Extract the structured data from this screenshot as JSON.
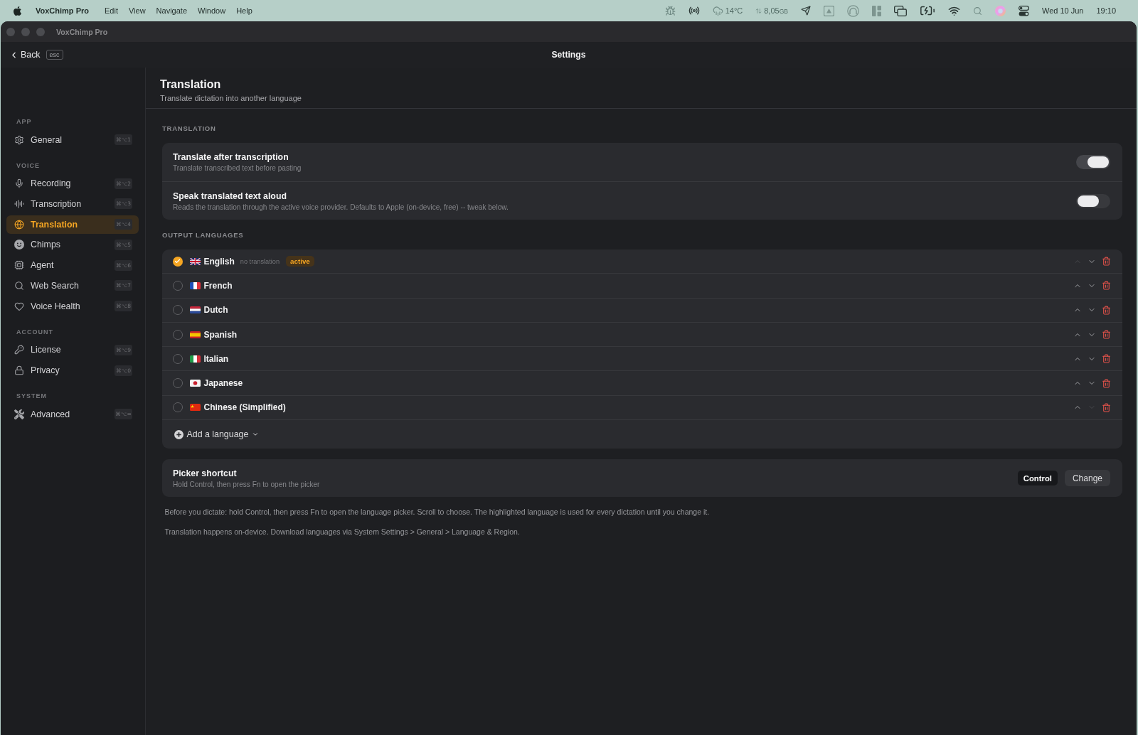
{
  "menu_bar": {
    "app_name": "VoxChimp Pro",
    "menus": [
      "Edit",
      "View",
      "Navigate",
      "Window",
      "Help"
    ],
    "weather": "14°C",
    "memory": "8,05",
    "memory_unit": "GB",
    "date": "Wed 10 Jun",
    "time": "19:10"
  },
  "window": {
    "title": "VoxChimp Pro"
  },
  "toolbar": {
    "back": "Back",
    "back_shortcut": "esc",
    "title": "Settings"
  },
  "sidebar": {
    "sections": [
      {
        "title": "APP",
        "items": [
          {
            "label": "General",
            "shortcut": "⌘⌥1",
            "selected": false
          }
        ]
      },
      {
        "title": "VOICE",
        "items": [
          {
            "label": "Recording",
            "shortcut": "⌘⌥2",
            "selected": false
          },
          {
            "label": "Transcription",
            "shortcut": "⌘⌥3",
            "selected": false
          },
          {
            "label": "Translation",
            "shortcut": "⌘⌥4",
            "selected": true
          },
          {
            "label": "Chimps",
            "shortcut": "⌘⌥5",
            "selected": false
          },
          {
            "label": "Agent",
            "shortcut": "⌘⌥6",
            "selected": false
          },
          {
            "label": "Web Search",
            "shortcut": "⌘⌥7",
            "selected": false
          },
          {
            "label": "Voice Health",
            "shortcut": "⌘⌥8",
            "selected": false
          }
        ]
      },
      {
        "title": "ACCOUNT",
        "items": [
          {
            "label": "License",
            "shortcut": "⌘⌥9",
            "selected": false
          },
          {
            "label": "Privacy",
            "shortcut": "⌘⌥0",
            "selected": false
          }
        ]
      },
      {
        "title": "SYSTEM",
        "items": [
          {
            "label": "Advanced",
            "shortcut": "⌘⌥=",
            "selected": false
          }
        ]
      }
    ]
  },
  "page": {
    "title": "Translation",
    "subtitle": "Translate dictation into another language"
  },
  "translation": {
    "heading": "TRANSLATION",
    "settings": [
      {
        "title": "Translate after transcription",
        "description": "Translate transcribed text before pasting",
        "on": true
      },
      {
        "title": "Speak translated text aloud",
        "description": "Reads the translation through the active voice provider. Defaults to Apple (on-device, free) -- tweak below.",
        "on": false
      }
    ]
  },
  "output_languages": {
    "heading": "OUTPUT LANGUAGES",
    "languages": [
      {
        "name": "English",
        "note": "no translation",
        "badge": "active",
        "selected": true,
        "move_up_disabled": true,
        "move_down_disabled": false
      },
      {
        "name": "French",
        "selected": false,
        "move_up_disabled": false,
        "move_down_disabled": false
      },
      {
        "name": "Dutch",
        "selected": false,
        "move_up_disabled": false,
        "move_down_disabled": false
      },
      {
        "name": "Spanish",
        "selected": false,
        "move_up_disabled": false,
        "move_down_disabled": false
      },
      {
        "name": "Italian",
        "selected": false,
        "move_up_disabled": false,
        "move_down_disabled": false
      },
      {
        "name": "Japanese",
        "selected": false,
        "move_up_disabled": false,
        "move_down_disabled": false
      },
      {
        "name": "Chinese (Simplified)",
        "selected": false,
        "move_up_disabled": false,
        "move_down_disabled": true
      }
    ],
    "add_button": "Add a language"
  },
  "picker_shortcut": {
    "title": "Picker shortcut",
    "description": "Hold Control, then press Fn to open the picker",
    "key": "Control",
    "button": "Change"
  },
  "notes": [
    "Before you dictate: hold Control, then press Fn to open the language picker. Scroll to choose. The highlighted language is used for every dictation until you change it.",
    "Translation happens on-device. Download languages via System Settings > General > Language & Region."
  ]
}
